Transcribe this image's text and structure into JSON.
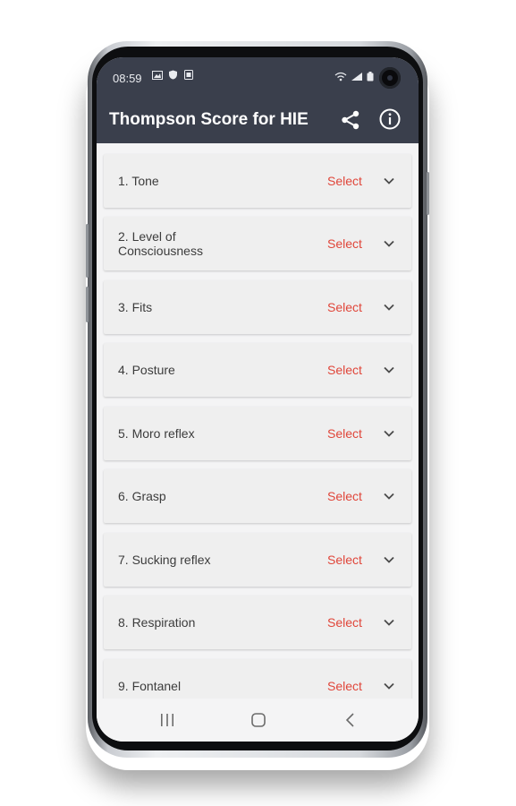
{
  "status_bar": {
    "time": "08:59",
    "left_icons": [
      "image-icon",
      "shield-icon",
      "sim-icon"
    ],
    "right_icons": [
      "wifi-icon",
      "signal-icon",
      "battery-icon"
    ]
  },
  "app_bar": {
    "title": "Thompson Score for HIE",
    "actions": [
      "share-icon",
      "info-icon"
    ]
  },
  "items": [
    {
      "label": "1. Tone",
      "action": "Select"
    },
    {
      "label": "2. Level of Consciousness",
      "action": "Select"
    },
    {
      "label": "3. Fits",
      "action": "Select"
    },
    {
      "label": "4. Posture",
      "action": "Select"
    },
    {
      "label": "5. Moro reflex",
      "action": "Select"
    },
    {
      "label": "6. Grasp",
      "action": "Select"
    },
    {
      "label": "7. Sucking reflex",
      "action": "Select"
    },
    {
      "label": "8. Respiration",
      "action": "Select"
    },
    {
      "label": "9. Fontanel",
      "action": "Select"
    }
  ],
  "colors": {
    "app_bar": "#3a3f4c",
    "select_accent": "#e0463a",
    "list_background": "#f4f4f5",
    "item_background": "#efefef"
  }
}
